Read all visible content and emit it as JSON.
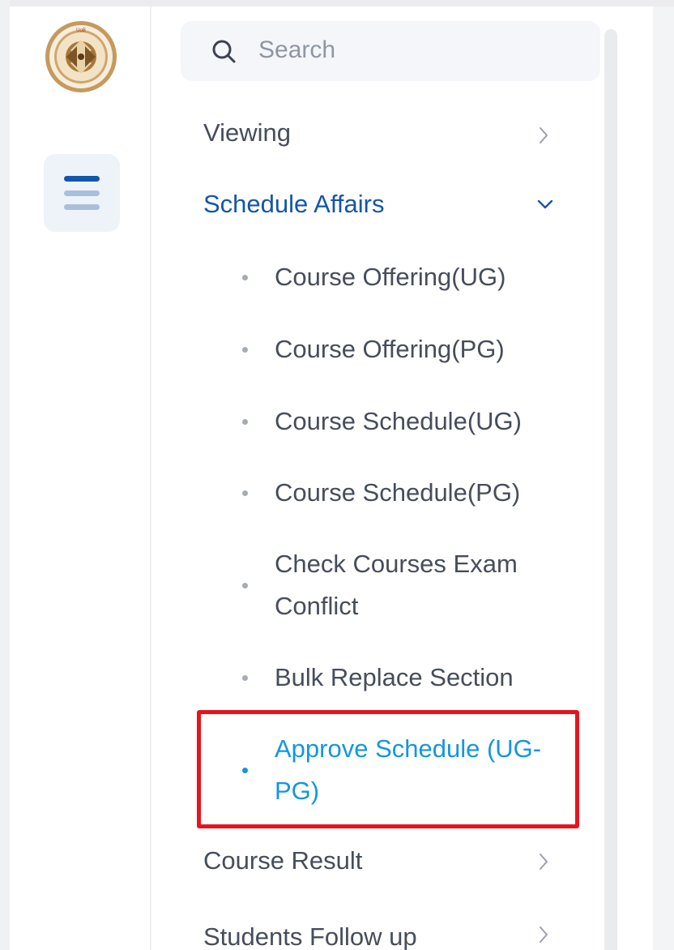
{
  "search": {
    "placeholder": "Search",
    "icon": "search-icon"
  },
  "rail": {
    "logo": "university-seal",
    "menu_icon": "hamburger-menu-icon"
  },
  "nav": {
    "items": [
      {
        "label": "Viewing",
        "state": "collapsed"
      },
      {
        "label": "Schedule Affairs",
        "state": "expanded",
        "children": [
          {
            "label": "Course Offering(UG)"
          },
          {
            "label": "Course Offering(PG)"
          },
          {
            "label": "Course Schedule(UG)"
          },
          {
            "label": "Course Schedule(PG)"
          },
          {
            "label_line1": "Check Courses Exam",
            "label_line2": "Conflict"
          },
          {
            "label": "Bulk Replace Section"
          },
          {
            "label_line1": "Approve Schedule (UG-",
            "label_line2": "PG)",
            "active": true
          }
        ]
      },
      {
        "label": "Course Result",
        "state": "collapsed"
      },
      {
        "label": "Students Follow up",
        "state": "collapsed"
      }
    ]
  },
  "colors": {
    "active_parent": "#1456a8",
    "active_child": "#1496df",
    "default_text": "#464d5b",
    "highlight_box": "#e8141b"
  }
}
